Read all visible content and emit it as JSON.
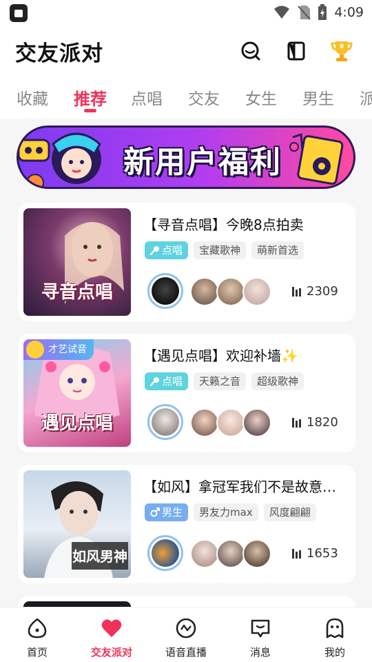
{
  "status_bar": {
    "time": "4:09"
  },
  "header": {
    "title": "交友派对"
  },
  "tabs": [
    {
      "label": "收藏"
    },
    {
      "label": "推荐"
    },
    {
      "label": "点唱"
    },
    {
      "label": "交友"
    },
    {
      "label": "女生"
    },
    {
      "label": "男生"
    },
    {
      "label": "派"
    }
  ],
  "active_tab": "推荐",
  "banner": {
    "text": "新用户福利"
  },
  "rooms": [
    {
      "title": "【寻音点唱】今晚8点拍卖",
      "cover_title": "寻音点唱",
      "category": "点唱",
      "category_icon": "microphone-icon",
      "tags": [
        "宝藏歌神",
        "萌新首选"
      ],
      "heat": "2309"
    },
    {
      "title": "【遇见点唱】欢迎补墙✨",
      "cover_title": "遇见点唱",
      "cover_badge": "才艺试音",
      "category": "点唱",
      "category_icon": "microphone-icon",
      "tags": [
        "天籁之音",
        "超级歌神"
      ],
      "heat": "1820"
    },
    {
      "title": "【如风】拿冠军我们不是故意…",
      "cover_title": "如风男神",
      "category": "男生",
      "category_icon": "male-icon",
      "tags": [
        "男友力max",
        "风度翩翩"
      ],
      "heat": "1653"
    }
  ],
  "bottom_nav": [
    {
      "label": "首页",
      "icon": "home-icon"
    },
    {
      "label": "交友派对",
      "icon": "heart-icon"
    },
    {
      "label": "语音直播",
      "icon": "voice-live-icon"
    },
    {
      "label": "消息",
      "icon": "message-icon"
    },
    {
      "label": "我的",
      "icon": "profile-ghost-icon"
    }
  ],
  "colors": {
    "accent": "#f0325a",
    "sing_tag": "#5fd3df",
    "male_tag": "#78aef0"
  }
}
